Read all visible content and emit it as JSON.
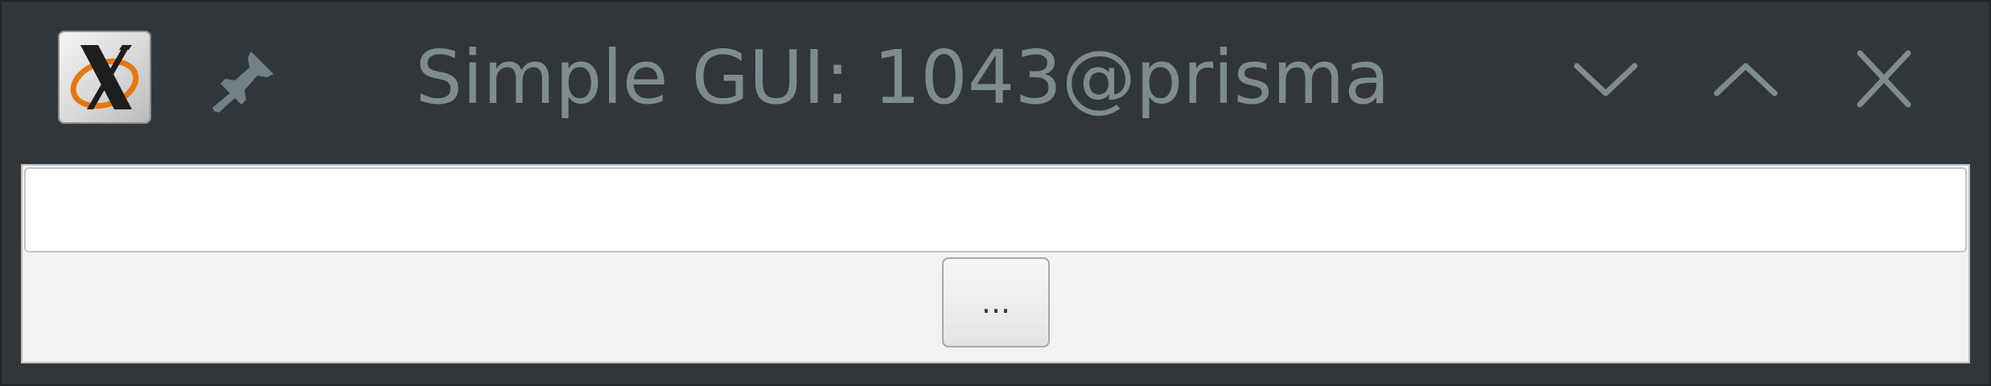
{
  "window": {
    "title": "Simple GUI: 1043@prisma",
    "icons": {
      "app": "x11-logo-icon",
      "pin": "pin-icon",
      "minimize": "chevron-down-icon",
      "maximize": "chevron-up-icon",
      "close": "close-icon"
    }
  },
  "form": {
    "input_value": "",
    "button_label": "..."
  },
  "colors": {
    "titlebar_bg": "#31363b",
    "title_text": "#7f8c8d",
    "client_bg": "#f2f2f2",
    "input_bg": "#ffffff",
    "logo_orange": "#e8760f"
  }
}
